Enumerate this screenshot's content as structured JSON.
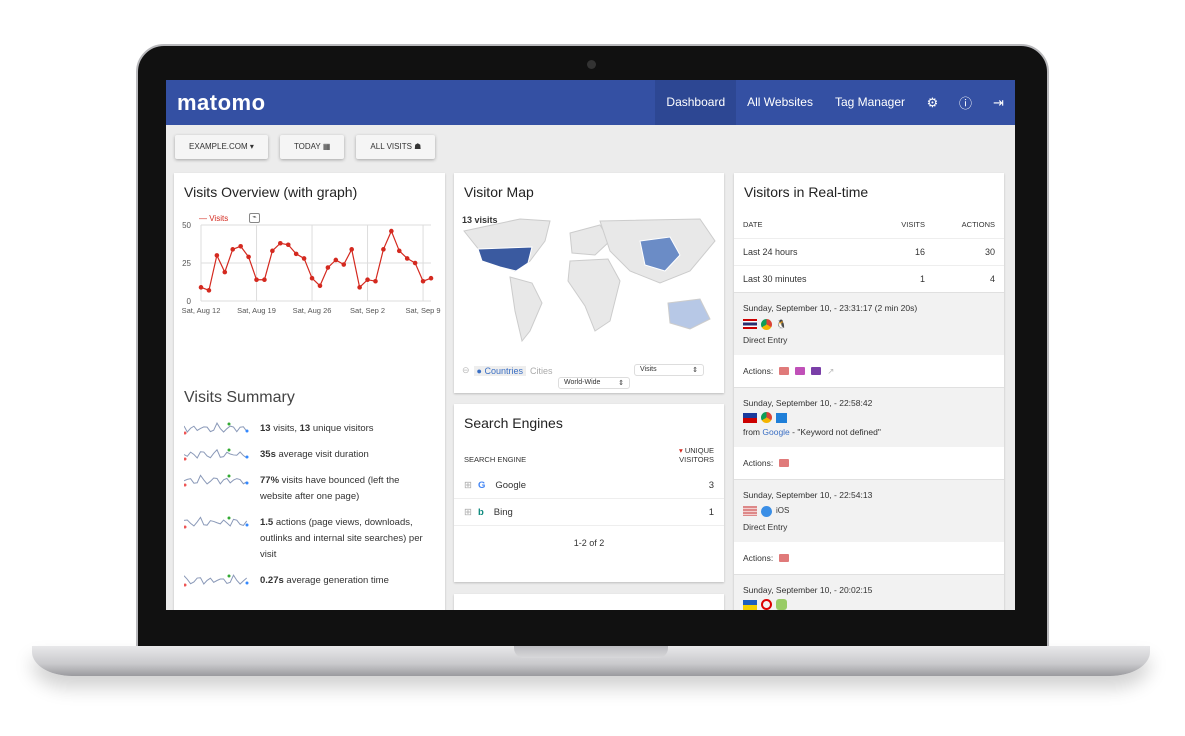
{
  "nav": {
    "logo": "matomo",
    "items": [
      "Dashboard",
      "All Websites",
      "Tag Manager"
    ],
    "active": "Dashboard",
    "icons": [
      "gear-icon",
      "info-icon",
      "logout-icon"
    ]
  },
  "toolbar": {
    "site": "EXAMPLE.COM",
    "period": "TODAY",
    "segment": "ALL VISITS"
  },
  "visits_overview": {
    "title": "Visits Overview (with graph)",
    "legend": "Visits"
  },
  "chart_data": {
    "type": "line",
    "series": [
      {
        "name": "Visits",
        "color": "#d4291f",
        "values": [
          9,
          7,
          30,
          19,
          34,
          36,
          29,
          14,
          14,
          33,
          38,
          37,
          31,
          28,
          15,
          10,
          22,
          27,
          24,
          34,
          9,
          14,
          13,
          34,
          46,
          33,
          28,
          25,
          13,
          15
        ]
      }
    ],
    "x_tick_labels": [
      "Sat, Aug 12",
      "Sat, Aug 19",
      "Sat, Aug 26",
      "Sat, Sep 2",
      "Sat, Sep 9"
    ],
    "y_ticks": [
      0,
      25,
      50
    ],
    "ylim": [
      0,
      50
    ],
    "grid": true,
    "legend": "top-left"
  },
  "summary": {
    "title": "Visits Summary",
    "rows": [
      {
        "bold": "13",
        "text": " visits, ",
        "bold2": "13",
        "text2": " unique visitors"
      },
      {
        "bold": "35s",
        "text": " average visit duration"
      },
      {
        "bold": "77%",
        "text": " visits have bounced (left the website after one page)"
      },
      {
        "bold": "1.5",
        "text": " actions (page views, downloads, outlinks and internal site searches) per visit"
      },
      {
        "bold": "0.27s",
        "text": " average generation time"
      }
    ]
  },
  "map": {
    "title": "Visitor Map",
    "count": "13 visits",
    "tab_countries": "Countries",
    "tab_cities": "Cities",
    "metric": "Visits",
    "region": "World-Wide"
  },
  "search": {
    "title": "Search Engines",
    "col1": "SEARCH ENGINE",
    "col2": "UNIQUE VISITORS",
    "rows": [
      {
        "name": "Google",
        "value": "3"
      },
      {
        "name": "Bing",
        "value": "1"
      }
    ],
    "pagination": "1-2 of 2"
  },
  "realtime": {
    "title": "Visitors in Real-time",
    "cols": [
      "DATE",
      "VISITS",
      "ACTIONS"
    ],
    "rows": [
      {
        "label": "Last 24 hours",
        "visits": "16",
        "actions": "30"
      },
      {
        "label": "Last 30 minutes",
        "visits": "1",
        "actions": "4"
      }
    ],
    "actions_label": "Actions:",
    "visits": [
      {
        "time": "Sunday, September 10, - 23:31:17 (2 min 20s)",
        "source": "Direct Entry"
      },
      {
        "time": "Sunday, September 10, - 22:58:42",
        "source_prefix": "from ",
        "source_link": "Google",
        "source_suffix": " - \"Keyword not defined\""
      },
      {
        "time": "Sunday, September 10, - 22:54:13",
        "os": "iOS",
        "source": "Direct Entry"
      },
      {
        "time": "Sunday, September 10, - 20:02:15"
      }
    ]
  }
}
